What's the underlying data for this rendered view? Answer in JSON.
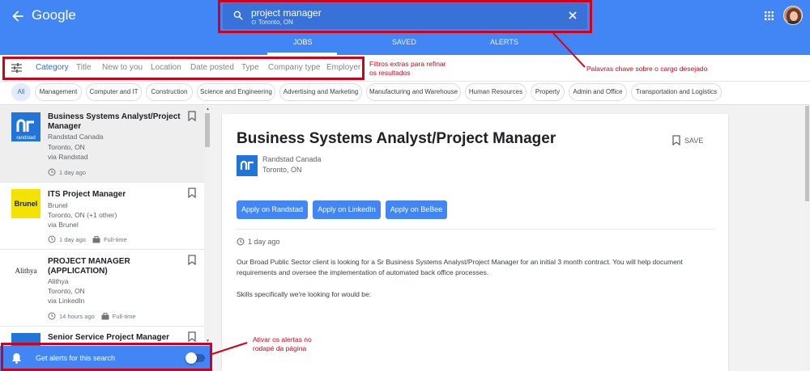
{
  "header": {
    "logo": "Google",
    "search_query": "project manager",
    "search_location": "Toronto, ON",
    "tabs": [
      "JOBS",
      "SAVED",
      "ALERTS"
    ]
  },
  "filters": {
    "items": [
      "Category",
      "Title",
      "New to you",
      "Location",
      "Date posted",
      "Type",
      "Company type",
      "Employer"
    ]
  },
  "chips": [
    "All",
    "Management",
    "Computer and IT",
    "Construction",
    "Science and Engineering",
    "Advertising and Marketing",
    "Manufacturing and Warehouse",
    "Human Resources",
    "Property",
    "Admin and Office",
    "Transportation and Logistics"
  ],
  "jobs": [
    {
      "title": "Business Systems Analyst/Project Manager",
      "company": "Randstad Canada",
      "location": "Toronto, ON",
      "via": "via Randstad",
      "posted": "1 day ago",
      "type": "",
      "logo": "randstad"
    },
    {
      "title": "ITS Project Manager",
      "company": "Brunel",
      "location": "Toronto, ON (+1 other)",
      "via": "via Brunel",
      "posted": "1 day ago",
      "type": "Full-time",
      "logo": "Brunel"
    },
    {
      "title": "PROJECT MANAGER (APPLICATION)",
      "company": "Alithya",
      "location": "Toronto, ON",
      "via": "via LinkedIn",
      "posted": "14 hours ago",
      "type": "Full-time",
      "logo": "Alithya"
    },
    {
      "title": "Senior Service Project Manager",
      "company": "",
      "location": "",
      "via": "",
      "posted": "",
      "type": "",
      "logo": "randstad"
    }
  ],
  "alert_bar": {
    "label": "Get alerts for this search",
    "enabled": false
  },
  "detail": {
    "title": "Business Systems Analyst/Project Manager",
    "save_label": "SAVE",
    "company": "Randstad Canada",
    "location": "Toronto, ON",
    "apply_buttons": [
      "Apply on Randstad",
      "Apply on LinkedIn",
      "Apply on BeBee"
    ],
    "posted": "1 day ago",
    "description": [
      "Our Broad Public Sector client is looking for a Sr Business Systems Analyst/Project Manager for an initial 3 month contract. You will help document requirements and oversee the implementation of automated back office processes.",
      "Skills specifically we're looking for would be:"
    ]
  },
  "annotations": {
    "search_note": "Palavras chave sobre o cargo desejado",
    "filter_note": "Filtros extras para refinar os resultados",
    "alert_note": "Ativar os alertas no rodapé da página"
  },
  "colors": {
    "brand_blue": "#4285f4",
    "annotation_red": "#d0021b",
    "link_blue": "#1a73e8"
  }
}
